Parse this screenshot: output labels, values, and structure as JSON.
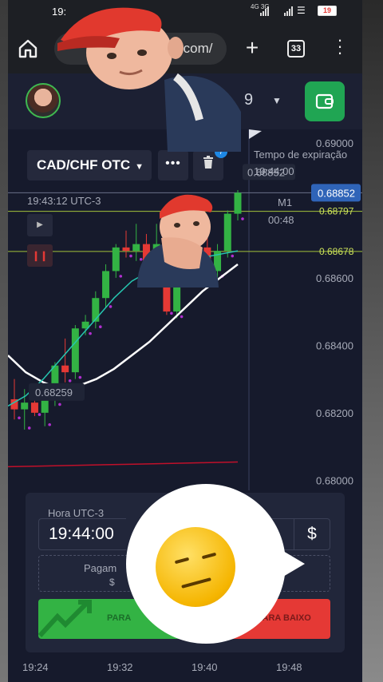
{
  "status_bar": {
    "time": "19:",
    "network": "4G 3G",
    "battery": "19"
  },
  "browser": {
    "url_text": "on.com/",
    "tab_count": "33"
  },
  "account": {
    "balance_fragment": "9"
  },
  "asset": {
    "pair": "CAD/CHF OTC",
    "trash_badge": "7"
  },
  "chart_header": {
    "expiry_label": "Tempo de expiração",
    "expiry_time": "19:44:00",
    "current_time": "19:43:12 UTC-3",
    "timeframe": "M1",
    "countdown": "00:48",
    "expiry_price": "0.68852"
  },
  "trade": {
    "hora_label": "Hora UTC-3",
    "hora_value": "19:44:00",
    "currency_symbol": "$",
    "payout_label": "Pagam",
    "payout_value": "$",
    "up_label": "PARA",
    "down_label": "PARA BAIXO"
  },
  "colors": {
    "up": "#33b344",
    "down": "#e53935",
    "accent": "#20a553",
    "price_tag": "#2f64b8"
  },
  "chart_data": {
    "type": "candlestick",
    "instrument": "CAD/CHF OTC",
    "timeframe": "M1",
    "x_ticks": [
      "19:24",
      "19:32",
      "19:40",
      "19:48"
    ],
    "y_ticks": [
      "0.69000",
      "0.68600",
      "0.68400",
      "0.68200",
      "0.68000"
    ],
    "ylim": [
      0.6797,
      0.6904
    ],
    "current_price": "0.68852",
    "level_labels": [
      "0.68797",
      "0.68678"
    ],
    "levels": [
      0.68797,
      0.68678
    ],
    "marker_price": "0.68259",
    "candles": [
      {
        "o": 0.6824,
        "h": 0.683,
        "l": 0.6818,
        "c": 0.6821
      },
      {
        "o": 0.6821,
        "h": 0.6827,
        "l": 0.6815,
        "c": 0.6823
      },
      {
        "o": 0.6823,
        "h": 0.6826,
        "l": 0.6819,
        "c": 0.682
      },
      {
        "o": 0.682,
        "h": 0.6827,
        "l": 0.6816,
        "c": 0.6824
      },
      {
        "o": 0.6824,
        "h": 0.6835,
        "l": 0.6822,
        "c": 0.6834
      },
      {
        "o": 0.6834,
        "h": 0.6842,
        "l": 0.6829,
        "c": 0.6832
      },
      {
        "o": 0.6832,
        "h": 0.6846,
        "l": 0.683,
        "c": 0.6845
      },
      {
        "o": 0.6845,
        "h": 0.6849,
        "l": 0.6843,
        "c": 0.6847
      },
      {
        "o": 0.6847,
        "h": 0.6856,
        "l": 0.6845,
        "c": 0.6854
      },
      {
        "o": 0.6854,
        "h": 0.6864,
        "l": 0.6851,
        "c": 0.6862
      },
      {
        "o": 0.6862,
        "h": 0.687,
        "l": 0.686,
        "c": 0.6869
      },
      {
        "o": 0.6869,
        "h": 0.6874,
        "l": 0.6866,
        "c": 0.6868
      },
      {
        "o": 0.6868,
        "h": 0.6876,
        "l": 0.6865,
        "c": 0.687
      },
      {
        "o": 0.687,
        "h": 0.6873,
        "l": 0.6859,
        "c": 0.686
      },
      {
        "o": 0.686,
        "h": 0.6876,
        "l": 0.6858,
        "c": 0.687
      },
      {
        "o": 0.687,
        "h": 0.6873,
        "l": 0.6849,
        "c": 0.685
      },
      {
        "o": 0.685,
        "h": 0.6868,
        "l": 0.6848,
        "c": 0.6866
      },
      {
        "o": 0.6866,
        "h": 0.6872,
        "l": 0.686,
        "c": 0.6863
      },
      {
        "o": 0.6863,
        "h": 0.687,
        "l": 0.6858,
        "c": 0.6869
      },
      {
        "o": 0.6869,
        "h": 0.6872,
        "l": 0.686,
        "c": 0.6862
      },
      {
        "o": 0.6862,
        "h": 0.687,
        "l": 0.686,
        "c": 0.6868
      },
      {
        "o": 0.6868,
        "h": 0.688,
        "l": 0.6866,
        "c": 0.6879
      },
      {
        "o": 0.6879,
        "h": 0.6886,
        "l": 0.6877,
        "c": 0.68852
      }
    ],
    "series": [
      {
        "name": "",
        "color": "#ffffff",
        "values": [
          0.6837,
          0.6832,
          0.6829,
          0.6827,
          0.6828,
          0.683,
          0.6833,
          0.6837,
          0.6841,
          0.6846,
          0.6851,
          0.6856,
          0.686,
          0.6864
        ]
      },
      {
        "name": "",
        "color": "#26c6b0",
        "values": [
          0.6822,
          0.6825,
          0.683,
          0.6836,
          0.6842,
          0.6848,
          0.6854,
          0.6859,
          0.6862,
          0.6864,
          0.6865,
          0.6866,
          0.6867,
          0.6868
        ]
      },
      {
        "name": "",
        "color": "#c0102a",
        "values": [
          0.6804,
          0.68042,
          0.68044,
          0.68046,
          0.68048,
          0.6805,
          0.68052,
          0.68054
        ]
      }
    ]
  }
}
